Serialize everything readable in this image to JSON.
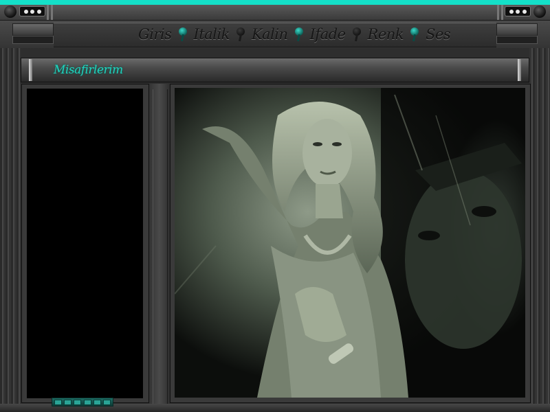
{
  "title_bar": {
    "left_icon": "window-dots-icon",
    "right_icon": "window-dots-icon"
  },
  "menu": {
    "items": [
      {
        "label": "Giris"
      },
      {
        "label": "Italik"
      },
      {
        "label": "Kalin"
      },
      {
        "label": "Ifade"
      },
      {
        "label": "Renk"
      },
      {
        "label": "Ses"
      }
    ],
    "separator_icon": "teal-note-icon"
  },
  "header": {
    "title": "Misafirlerim"
  },
  "colors": {
    "accent": "#14e0c8",
    "background": "#2e2e2e",
    "panel": "#000000"
  },
  "main": {
    "image_icon": "photo-portrait-icon"
  },
  "footer": {
    "counter_icon": "visitor-counter-icon"
  }
}
